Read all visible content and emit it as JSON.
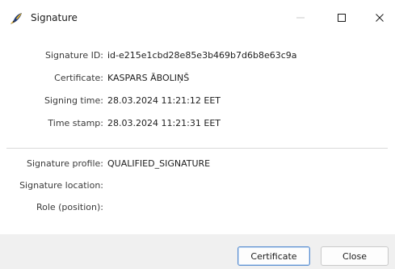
{
  "window": {
    "title": "Signature",
    "icon": "signature-quill-icon"
  },
  "caption_buttons": {
    "minimize": "minimize-icon",
    "maximize": "maximize-icon",
    "close": "close-icon"
  },
  "details": [
    {
      "label": "Signature ID:",
      "value": "id-e215e1cbd28e85e3b469b7d6b8e63c9a"
    },
    {
      "label": "Certificate:",
      "value": "KASPARS ĀBOLIŅŠ"
    },
    {
      "label": "Signing time:",
      "value": "28.03.2024 11:21:12 EET"
    },
    {
      "label": "Time stamp:",
      "value": "28.03.2024 11:21:31 EET"
    }
  ],
  "profile": [
    {
      "label": "Signature profile:",
      "value": "QUALIFIED_SIGNATURE"
    },
    {
      "label": "Signature location:",
      "value": ""
    },
    {
      "label": "Role (position):",
      "value": ""
    }
  ],
  "footer": {
    "certificate_button": "Certificate",
    "close_button": "Close"
  },
  "colors": {
    "footer_bg": "#f0f0f0",
    "focus_border": "#5b8fd0"
  }
}
